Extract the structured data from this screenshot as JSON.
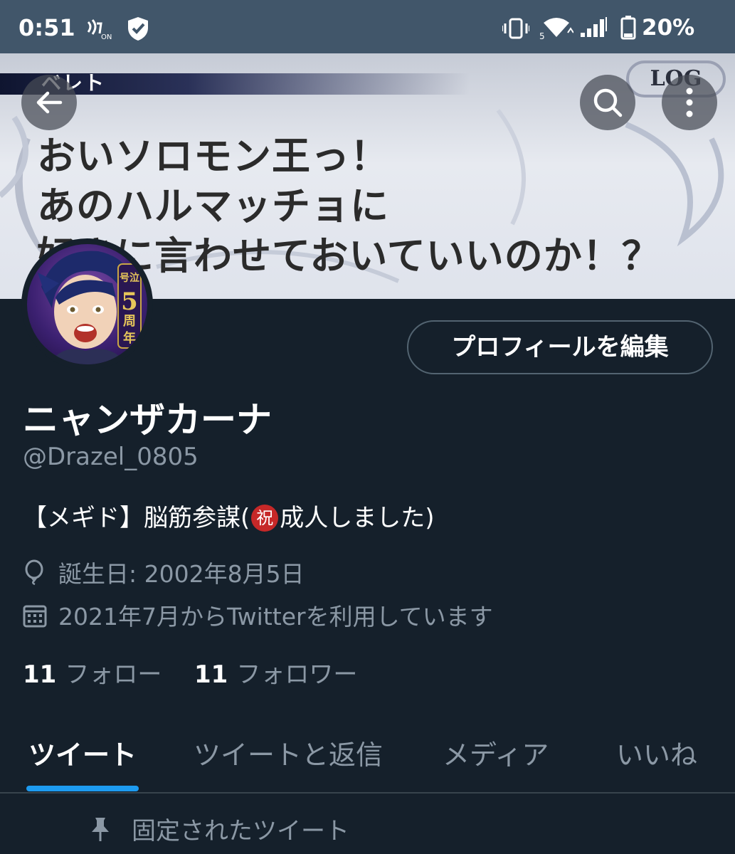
{
  "status_bar": {
    "time": "0:51",
    "nfc_icon_label": "ON",
    "network_label": "5",
    "battery_percent": "20%"
  },
  "header": {
    "banner": {
      "speaker_name": "ベレト",
      "log_label": "LOG",
      "lines": [
        "おいソロモン王っ！",
        "あのハルマッチョに",
        "好きに言わせておいていいのか！？"
      ]
    },
    "avatar_badge_lines": [
      "号泣",
      "5",
      "周",
      "年"
    ]
  },
  "profile": {
    "edit_button_label": "プロフィールを編集",
    "display_name": "ニャンザカーナ",
    "handle": "@Drazel_0805",
    "bio_before": "【メギド】脳筋参謀(",
    "bio_badge": "祝",
    "bio_after": "成人しました)",
    "birthday": "誕生日: 2002年8月5日",
    "joined": "2021年7月からTwitterを利用しています",
    "following_count": "11",
    "following_label": "フォロー",
    "followers_count": "11",
    "followers_label": "フォロワー"
  },
  "tabs": [
    {
      "label": "ツイート",
      "active": true
    },
    {
      "label": "ツイートと返信",
      "active": false
    },
    {
      "label": "メディア",
      "active": false
    },
    {
      "label": "いいね",
      "active": false
    }
  ],
  "pinned_label": "固定されたツイート",
  "colors": {
    "background": "#15202b",
    "status_bar": "#41566a",
    "accent": "#1d9bf0",
    "secondary_text": "#8b98a5",
    "badge_red": "#c62828"
  }
}
